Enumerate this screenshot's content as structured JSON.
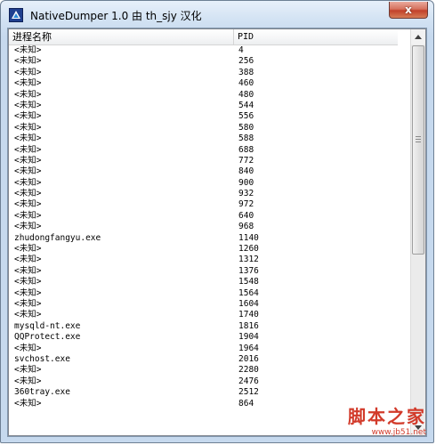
{
  "window": {
    "title": "NativeDumper 1.0 由 th_sjy 汉化",
    "close_glyph": "x"
  },
  "listview": {
    "columns": {
      "name": "进程名称",
      "pid": "PID"
    },
    "rows": [
      {
        "name": "<未知>",
        "pid": "4"
      },
      {
        "name": "<未知>",
        "pid": "256"
      },
      {
        "name": "<未知>",
        "pid": "388"
      },
      {
        "name": "<未知>",
        "pid": "460"
      },
      {
        "name": "<未知>",
        "pid": "480"
      },
      {
        "name": "<未知>",
        "pid": "544"
      },
      {
        "name": "<未知>",
        "pid": "556"
      },
      {
        "name": "<未知>",
        "pid": "580"
      },
      {
        "name": "<未知>",
        "pid": "588"
      },
      {
        "name": "<未知>",
        "pid": "688"
      },
      {
        "name": "<未知>",
        "pid": "772"
      },
      {
        "name": "<未知>",
        "pid": "840"
      },
      {
        "name": "<未知>",
        "pid": "900"
      },
      {
        "name": "<未知>",
        "pid": "932"
      },
      {
        "name": "<未知>",
        "pid": "972"
      },
      {
        "name": "<未知>",
        "pid": "640"
      },
      {
        "name": "<未知>",
        "pid": "968"
      },
      {
        "name": "zhudongfangyu.exe",
        "pid": "1140"
      },
      {
        "name": "<未知>",
        "pid": "1260"
      },
      {
        "name": "<未知>",
        "pid": "1312"
      },
      {
        "name": "<未知>",
        "pid": "1376"
      },
      {
        "name": "<未知>",
        "pid": "1548"
      },
      {
        "name": "<未知>",
        "pid": "1564"
      },
      {
        "name": "<未知>",
        "pid": "1604"
      },
      {
        "name": "<未知>",
        "pid": "1740"
      },
      {
        "name": "mysqld-nt.exe",
        "pid": "1816"
      },
      {
        "name": "QQProtect.exe",
        "pid": "1904"
      },
      {
        "name": "<未知>",
        "pid": "1964"
      },
      {
        "name": "svchost.exe",
        "pid": "2016"
      },
      {
        "name": "<未知>",
        "pid": "2280"
      },
      {
        "name": "<未知>",
        "pid": "2476"
      },
      {
        "name": "360tray.exe",
        "pid": "2512"
      },
      {
        "name": "<未知>",
        "pid": "864"
      }
    ]
  },
  "watermark": {
    "main": "脚本之家",
    "sub": "www.jb51.net"
  },
  "colors": {
    "watermark": "#d23a2a",
    "titlebar": "#d2e2f3",
    "close_button": "#c2412a"
  }
}
